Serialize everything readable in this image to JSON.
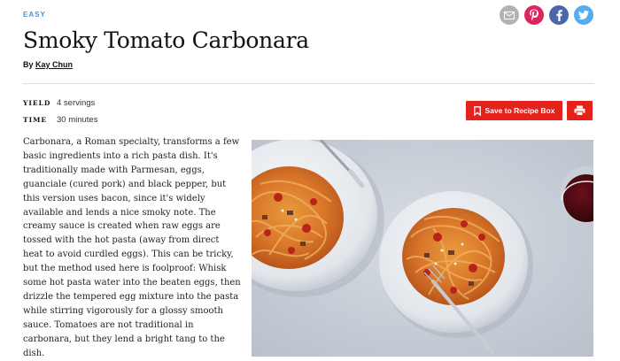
{
  "recipe": {
    "difficulty": "EASY",
    "title": "Smoky Tomato Carbonara",
    "byline_prefix": "By ",
    "author": "Kay Chun",
    "yield_label": "YIELD",
    "yield_value": "4 servings",
    "time_label": "TIME",
    "time_value": "30 minutes",
    "intro": "Carbonara, a Roman specialty, transforms a few basic ingredients into a rich pasta dish. It's traditionally made with Parmesan, eggs, guanciale (cured pork) and black pepper, but this version uses bacon, since it's widely available and lends a nice smoky note. The creamy sauce is created when raw eggs are tossed with the hot pasta (away from direct heat to avoid curdled eggs). This can be tricky, but the method used here is foolproof: Whisk some hot pasta water into the beaten eggs, then drizzle the tempered egg mixture into the pasta while stirring vigorously for a glossy smooth sauce. Tomatoes are not traditional in carbonara, but they lend a bright tang to the dish."
  },
  "actions": {
    "save_label": "Save to Recipe Box",
    "save_icon": "bookmark-icon",
    "print_icon": "printer-icon"
  },
  "share": [
    {
      "icon": "email-icon",
      "color": "#b3b3b3"
    },
    {
      "icon": "pinterest-icon",
      "color": "#e0245e"
    },
    {
      "icon": "facebook-icon",
      "color": "#4c67a8"
    },
    {
      "icon": "twitter-icon",
      "color": "#55acee"
    }
  ],
  "colors": {
    "accent": "#e3221b",
    "difficulty": "#4a90d9"
  }
}
